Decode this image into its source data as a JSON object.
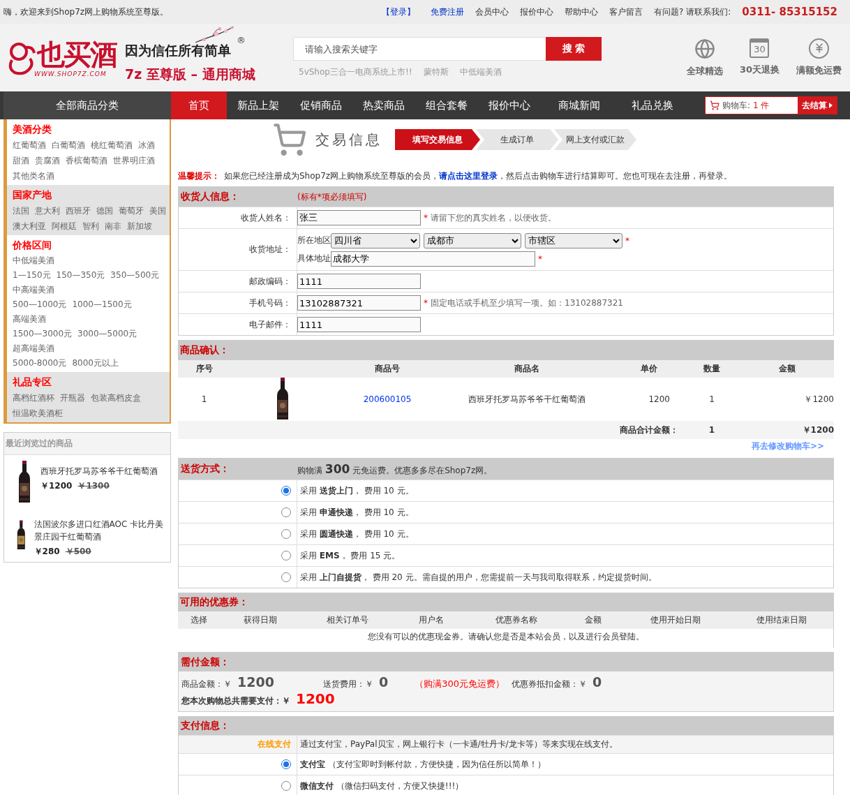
{
  "top_bar": {
    "greeting": "嗨，欢迎来到Shop7z网上购物系统至尊版。",
    "links": [
      {
        "label": "【登录】",
        "kind": "accent"
      },
      {
        "label": "免费注册",
        "kind": "accent"
      },
      {
        "label": "会员中心",
        "kind": "plain"
      },
      {
        "label": "报价中心",
        "kind": "plain"
      },
      {
        "label": "帮助中心",
        "kind": "plain"
      },
      {
        "label": "客户留言",
        "kind": "plain"
      }
    ],
    "contact_label": "有问题? 请联系我们:",
    "phone": "0311- 85315152"
  },
  "header": {
    "logo_text": "也买酒",
    "logo_url": "WWW.SHOP7Z.COM",
    "slogan": "因为信任所有简单",
    "registered_mark": "®",
    "edition": "7z 至尊版 – 通用商城",
    "search": {
      "placeholder": "请输入搜索关键字",
      "button": "搜 索",
      "hot_words": [
        "5vShop三合一电商系统上市!!",
        "蒙特斯",
        "中低端美酒"
      ]
    },
    "features": [
      {
        "label": "全球精选",
        "kind": "globe"
      },
      {
        "label": "30天退换",
        "kind": "calendar",
        "number": "30"
      },
      {
        "label": "满额免运费",
        "kind": "yen"
      }
    ]
  },
  "nav": {
    "all_categories": "全部商品分类",
    "items": [
      {
        "label": "首页",
        "selected": true
      },
      {
        "label": "新品上架",
        "selected": false
      },
      {
        "label": "促销商品",
        "selected": false
      },
      {
        "label": "热卖商品",
        "selected": false
      },
      {
        "label": "组合套餐",
        "selected": false
      },
      {
        "label": "报价中心",
        "selected": false
      },
      {
        "label": "商城新闻",
        "selected": false
      },
      {
        "label": "礼品兑换",
        "selected": false
      }
    ],
    "cart": {
      "label": "购物车:",
      "count": "1 件",
      "checkout": "去结算"
    }
  },
  "sidebar": {
    "sections": [
      {
        "title": "美酒分类",
        "groups": [
          {
            "links": [
              "红葡萄酒",
              "白葡萄酒",
              "桃红葡萄酒",
              "冰酒",
              "甜酒",
              "贵腐酒",
              "香槟葡萄酒",
              "世界明庄酒",
              "其他类名酒"
            ]
          }
        ]
      },
      {
        "title": "国家产地",
        "groups": [
          {
            "links": [
              "法国",
              "意大利",
              "西班牙",
              "德国",
              "葡萄牙",
              "美国",
              "澳大利亚",
              "阿根廷",
              "智利",
              "南非",
              "新加坡"
            ]
          }
        ]
      },
      {
        "title": "价格区间",
        "groups": [
          {
            "label": "中低端美酒",
            "links": [
              "1—150元",
              "150—350元",
              "350—500元"
            ]
          },
          {
            "label": "中高端美酒",
            "links": [
              "500—1000元",
              "1000—1500元"
            ]
          },
          {
            "label": "高端美酒",
            "links": [
              "1500—3000元",
              "3000—5000元"
            ]
          },
          {
            "label": "超高端美酒",
            "links": [
              "5000-8000元",
              "8000元以上"
            ]
          }
        ]
      },
      {
        "title": "礼品专区",
        "groups": [
          {
            "links": [
              "高档红酒杯",
              "开瓶器",
              "包装高档皮盒",
              "恒温欧美酒柜"
            ]
          }
        ]
      }
    ],
    "recent": {
      "title": "最近浏览过的商品",
      "items": [
        {
          "name": "西班牙托罗马苏爷爷干红葡萄酒",
          "price": "￥1200",
          "old_price": "￥1300"
        },
        {
          "name": "法国波尔多进口红酒AOC 卡比丹美景庄园干红葡萄酒",
          "price": "￥280",
          "old_price": "￥500"
        }
      ]
    }
  },
  "checkout": {
    "title": "交易信息",
    "steps": [
      {
        "label": "填写交易信息",
        "selected": true
      },
      {
        "label": "生成订单",
        "selected": false
      },
      {
        "label": "网上支付或汇款",
        "selected": false
      }
    ],
    "tip": {
      "label": "温馨提示：",
      "before": "如果您已经注册成为Shop7z网上购物系统至尊版的会员，",
      "link": "请点击这里登录",
      "after": "，然后点击购物车进行结算即可。您也可现在去注册，再登录。"
    },
    "receiver": {
      "title": "收货人信息：",
      "note": "(标有*项必须填写)",
      "fields": [
        {
          "kind": "text",
          "label": "收货人姓名：",
          "value": "张三",
          "mark": "*",
          "hint": "请留下您的真实姓名，以便收货。"
        },
        {
          "kind": "address",
          "label": "收货地址：",
          "region_label": "所在地区",
          "selects": [
            "四川省",
            "成都市",
            "市辖区"
          ],
          "mark": "*",
          "detail_label": "具体地址",
          "value": "成都大学",
          "detail_mark": "*"
        },
        {
          "kind": "text",
          "label": "邮政编码：",
          "value": "1111"
        },
        {
          "kind": "text",
          "label": "手机号码：",
          "value": "13102887321",
          "mark": "*",
          "hint": "固定电话或手机至少填写一项。如：13102887321"
        },
        {
          "kind": "text",
          "label": "电子邮件：",
          "value": "1111"
        }
      ]
    },
    "products": {
      "title": "商品确认：",
      "columns": [
        "序号",
        "商品号",
        "商品名",
        "单价",
        "数量",
        "金额"
      ],
      "rows": [
        {
          "index": "1",
          "code": "200600105",
          "name": "西班牙托罗马苏爷爷干红葡萄酒",
          "price": "1200",
          "qty": "1",
          "amount": "￥1200"
        }
      ],
      "total": {
        "label": "商品合计金额：",
        "qty": "1",
        "amount": "￥1200"
      },
      "edit_link": "再去修改购物车>>"
    },
    "delivery": {
      "title": "送货方式：",
      "note": "购物满 **300** 元免运费。优惠多多尽在Shop7z网。",
      "options": [
        {
          "selected": true,
          "text": "采用 **送货上门**， 费用 10 元。"
        },
        {
          "selected": false,
          "text": "采用 **申通快递**， 费用 10 元。"
        },
        {
          "selected": false,
          "text": "采用 **圆通快递**， 费用 10 元。"
        },
        {
          "selected": false,
          "text": "采用 **EMS**， 费用 15 元。"
        },
        {
          "selected": false,
          "text": "采用 **上门自提货**， 费用 20 元。需自提的用户，您需提前一天与我司取得联系，约定提货时间。"
        }
      ]
    },
    "coupons": {
      "title": "可用的优惠券：",
      "columns": [
        "选择",
        "获得日期",
        "相关订单号",
        "用户名",
        "优惠券名称",
        "金额",
        "使用开始日期",
        "使用结束日期"
      ],
      "empty": "您没有可以的优惠现金券。请确认您是否是本站会员，以及进行会员登陆。"
    },
    "amount": {
      "title": "需付金额：",
      "goods_label": "商品金额：￥",
      "goods": "1200",
      "shipping_label": "送货费用：￥",
      "shipping": "0",
      "free_note": "（购满300元免运费）",
      "coupon_label": "优惠券抵扣金额：￥",
      "coupon": "0",
      "total_label": "您本次购物总共需要支付：￥",
      "total": "1200"
    },
    "payment": {
      "title": "支付信息：",
      "online_label": "在线支付",
      "online_text": "通过支付宝，PayPal贝宝，网上银行卡（一卡通/牡丹卡/龙卡等）等来实现在线支付。",
      "options": [
        {
          "selected": true,
          "text": "**支付宝** （支付宝即时到帐付款，方便快捷，因为信任所以简单！）"
        },
        {
          "selected": false,
          "text": "**微信支付** （微信扫码支付，方便又快捷!!!）"
        }
      ]
    }
  }
}
